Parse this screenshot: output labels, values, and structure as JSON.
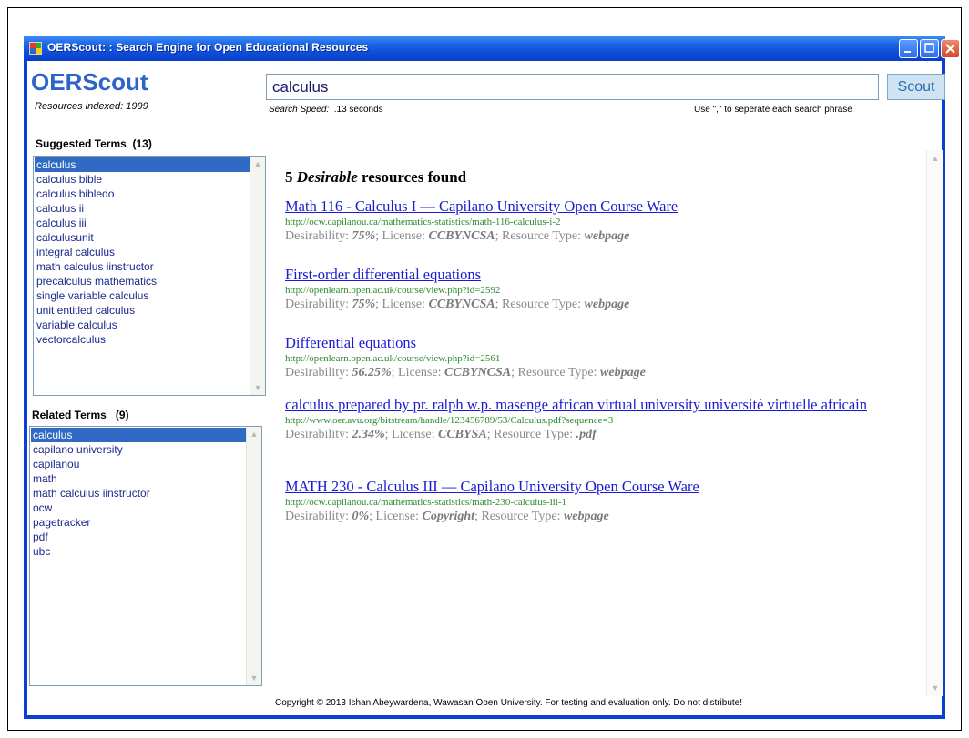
{
  "window": {
    "title": "OERScout: : Search Engine for Open Educational Resources"
  },
  "logo": {
    "name": "OERScout",
    "indexed": "Resources indexed: 1999"
  },
  "search": {
    "query": "calculus",
    "button_label": "Scout",
    "speed_label": "Search Speed:",
    "speed_value": ".13 seconds",
    "hint": "Use \",\" to seperate each search phrase"
  },
  "suggested": {
    "label": "Suggested Terms",
    "count": "(13)",
    "items": [
      "calculus",
      "calculus bible",
      "calculus bibledo",
      "calculus ii",
      "calculus iii",
      "calculusunit",
      "integral calculus",
      "math calculus iinstructor",
      "precalculus mathematics",
      "single variable calculus",
      "unit entitled calculus",
      "variable calculus",
      "vectorcalculus"
    ]
  },
  "related": {
    "label": "Related Terms",
    "count": "(9)",
    "items": [
      "calculus",
      "capilano university",
      "capilanou",
      "math",
      "math calculus iinstructor",
      "ocw",
      "pagetracker",
      "pdf",
      "ubc"
    ]
  },
  "results": {
    "count": "5",
    "found_word": "Desirable",
    "found_tail": "resources found",
    "desirability_label": "Desirability:",
    "license_label": "; License:",
    "type_label": "; Resource Type:",
    "items": [
      {
        "title": "Math 116 - Calculus I — Capilano University Open Course Ware",
        "url": "http://ocw.capilanou.ca/mathematics-statistics/math-116-calculus-i-2",
        "desirability": "75%",
        "license": "CCBYNCSA",
        "type": "webpage"
      },
      {
        "title": "First-order differential equations",
        "url": "http://openlearn.open.ac.uk/course/view.php?id=2592",
        "desirability": "75%",
        "license": "CCBYNCSA",
        "type": "webpage"
      },
      {
        "title": "Differential equations",
        "url": "http://openlearn.open.ac.uk/course/view.php?id=2561",
        "desirability": "56.25%",
        "license": "CCBYNCSA",
        "type": "webpage"
      },
      {
        "title": "calculus prepared by pr. ralph w.p. masenge african virtual university université virtuelle africain",
        "url": "http://www.oer.avu.org/bitstream/handle/123456789/53/Calculus.pdf?sequence=3",
        "desirability": "2.34%",
        "license": "CCBYSA",
        "type": ".pdf"
      },
      {
        "title": "MATH 230 - Calculus III — Capilano University Open Course Ware",
        "url": "http://ocw.capilanou.ca/mathematics-statistics/math-230-calculus-iii-1",
        "desirability": "0%",
        "license": "Copyright",
        "type": "webpage"
      }
    ]
  },
  "footer": {
    "copyright": "Copyright © 2013 Ishan Abeywardena, Wawasan Open University. For testing and evaluation only. Do not distribute!"
  },
  "colors": {
    "titlebar": "#0b4bd6",
    "logo": "#2e63c7",
    "selection": "#316ac5",
    "link": "#1a1ad6",
    "url": "#2b8a2b"
  }
}
